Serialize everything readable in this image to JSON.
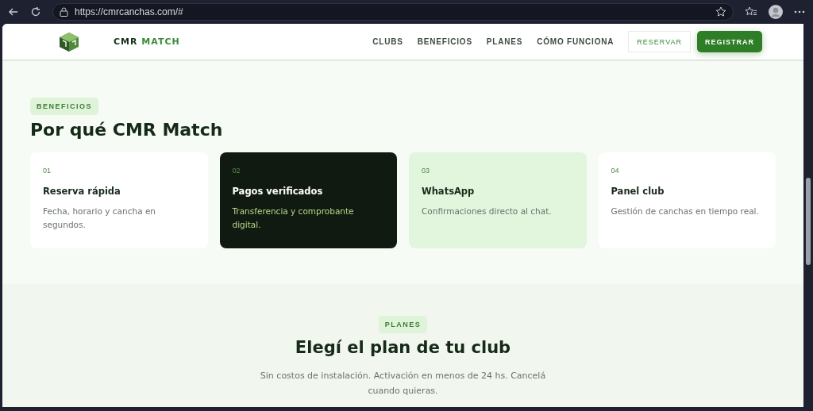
{
  "browser": {
    "url": "https://cmrcanchas.com/#"
  },
  "header": {
    "brand_first": "CMR",
    "brand_second": "MATCH",
    "nav": [
      "CLUBS",
      "BENEFICIOS",
      "PLANES",
      "CÓMO FUNCIONA"
    ],
    "reserve_button": "RESERVAR",
    "register_button": "REGISTRAR"
  },
  "benefits": {
    "tag": "BENEFICIOS",
    "title": "Por qué CMR Match",
    "cards": [
      {
        "kind": "light",
        "number": "01",
        "title": "Reserva rápida",
        "text": "Fecha, horario y cancha en segundos."
      },
      {
        "kind": "dark",
        "number": "02",
        "title": "Pagos verificados",
        "text": "Transferencia y comprobante digital."
      },
      {
        "kind": "tint",
        "number": "03",
        "title": "WhatsApp",
        "text": "Confirmaciones directo al chat."
      },
      {
        "kind": "light",
        "number": "04",
        "title": "Panel club",
        "text": "Gestión de canchas en tiempo real."
      }
    ]
  },
  "plans": {
    "tag": "PLANES",
    "title": "Elegí el plan de tu club",
    "subtitle": "Sin costos de instalación. Activación en menos de 24 hs. Cancelá cuando quieras."
  }
}
